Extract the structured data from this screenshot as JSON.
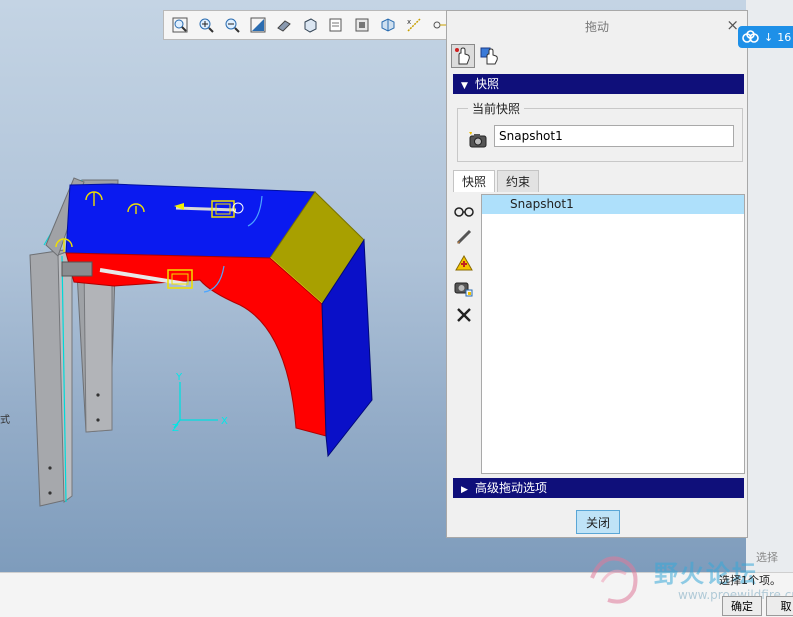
{
  "dialog": {
    "title": "拖动",
    "close_glyph": "×",
    "section_snapshots": "快照",
    "current_snapshot_label": "当前快照",
    "current_snapshot_value": "Snapshot1",
    "tabs": [
      {
        "label": "快照",
        "active": true
      },
      {
        "label": "约束",
        "active": false
      }
    ],
    "snapshot_list": [
      "Snapshot1"
    ],
    "section_advanced": "高级拖动选项",
    "close_button": "关闭"
  },
  "toolbar_icons": [
    "refit-icon",
    "zoom-in-icon",
    "zoom-out-icon",
    "repaint-icon",
    "display-style-icon",
    "saved-orientations-icon",
    "view-manager-icon",
    "layers-icon",
    "perspective-icon",
    "datum-display-icon",
    "annotation-display-icon"
  ],
  "side_tool_icons": [
    "view-snapshot-icon",
    "edit-snapshot-icon",
    "warning-icon",
    "camera-icon",
    "delete-icon"
  ],
  "viewport": {
    "side_label": "式",
    "axis_x": "X",
    "axis_y": "Y",
    "axis_z": "Z",
    "part_colors": {
      "top": "#0a1af0",
      "front": "#ff0000",
      "side": "#0a10c8",
      "chamfer": "#a8a000",
      "legs": "#a6a8ac"
    }
  },
  "badge": {
    "text": "16"
  },
  "status": {
    "filter_label": "选择",
    "message": "选择1个项。",
    "ok_button": "确定",
    "cancel_button": "取"
  },
  "watermark": {
    "text": "野火论坛",
    "url": "www.proewildfire.cn"
  }
}
